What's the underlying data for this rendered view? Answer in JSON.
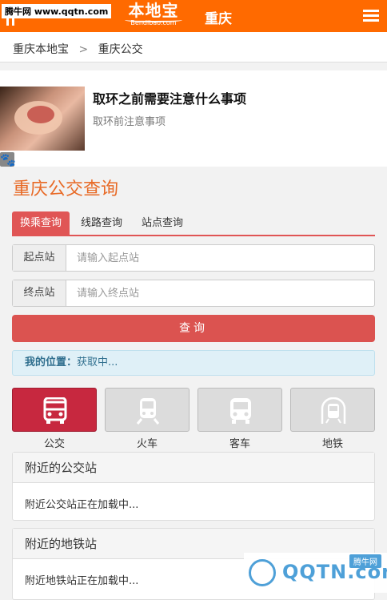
{
  "watermark": {
    "top_left": "腾牛网 www.qqtn.com",
    "bottom_right_text": "QQTN.com",
    "bottom_right_badge": "腾牛网"
  },
  "header": {
    "logo_big": "本地宝",
    "logo_small": "Bendibao.com",
    "city": "重庆",
    "accent": "#ff6a00"
  },
  "breadcrumb": {
    "home": "重庆本地宝",
    "sep": ">",
    "current": "重庆公交"
  },
  "ad": {
    "title": "取环之前需要注意什么事项",
    "subtitle": "取环前注意事项"
  },
  "page": {
    "title": "重庆公交查询"
  },
  "tabs": [
    {
      "label": "换乘查询",
      "active": true
    },
    {
      "label": "线路查询",
      "active": false
    },
    {
      "label": "站点查询",
      "active": false
    }
  ],
  "form": {
    "start": {
      "label": "起点站",
      "placeholder": "请输入起点站",
      "value": ""
    },
    "end": {
      "label": "终点站",
      "placeholder": "请输入终点站",
      "value": ""
    },
    "submit": "查询"
  },
  "location": {
    "label": "我的位置：",
    "value": "获取中..."
  },
  "modes": [
    {
      "label": "公交",
      "icon": "bus-icon",
      "active": true
    },
    {
      "label": "火车",
      "icon": "train-icon",
      "active": false
    },
    {
      "label": "客车",
      "icon": "coach-icon",
      "active": false
    },
    {
      "label": "地铁",
      "icon": "subway-icon",
      "active": false
    }
  ],
  "nearby_bus": {
    "title": "附近的公交站",
    "status": "附近公交站正在加载中..."
  },
  "nearby_subway": {
    "title": "附近的地铁站",
    "status": "附近地铁站正在加载中..."
  },
  "colors": {
    "active_tab": "#e05555",
    "active_mode": "#c7283f",
    "query_button": "#db5350",
    "title": "#e86a26"
  }
}
